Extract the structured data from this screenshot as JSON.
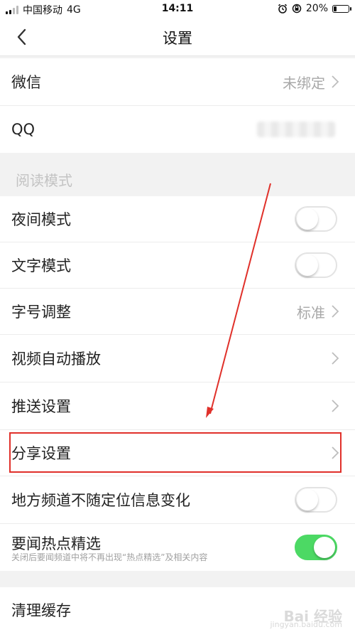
{
  "status_bar": {
    "carrier": "中国移动",
    "network": "4G",
    "time": "14:11",
    "battery": "20%",
    "battery_level": 0.2
  },
  "nav": {
    "title": "设置",
    "back_icon": "chevron-left-icon"
  },
  "account": {
    "wechat_label": "微信",
    "wechat_value": "未绑定",
    "qq_label": "QQ"
  },
  "reading": {
    "section_title": "阅读模式",
    "night_mode_label": "夜间模式",
    "night_mode_on": false,
    "text_mode_label": "文字模式",
    "text_mode_on": false,
    "font_size_label": "字号调整",
    "font_size_value": "标准",
    "auto_play_label": "视频自动播放",
    "push_label": "推送设置",
    "share_label": "分享设置",
    "local_channel_label": "地方频道不随定位信息变化",
    "local_channel_on": false,
    "hot_picks_label": "要闻热点精选",
    "hot_picks_desc": "关闭后要闻频道中将不再出现“热点精选”及相关内容",
    "hot_picks_on": true
  },
  "cache": {
    "clear_cache_label": "清理缓存"
  },
  "watermark": {
    "main": "Bai 经验",
    "url": "jingyan.baidu.com"
  },
  "colors": {
    "switch_on": "#4cd964",
    "annotation_red": "#e0302a"
  }
}
